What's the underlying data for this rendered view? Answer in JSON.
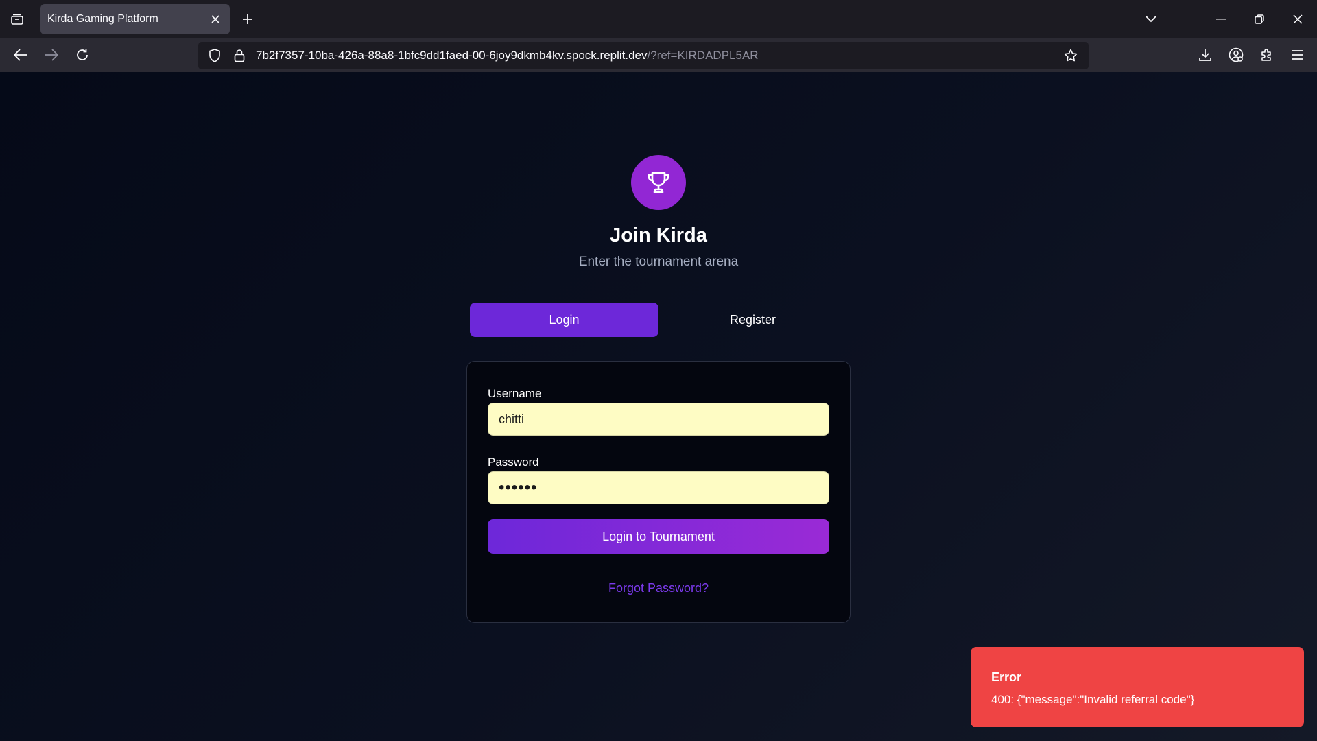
{
  "browser": {
    "tab": {
      "title": "Kirda Gaming Platform"
    },
    "url": {
      "host": "7b2f7357-10ba-426a-88a8-1bfc9dd1faed-00-6joy9dkmb4kv.spock.replit.dev",
      "query": "/?ref=KIRDADPL5AR"
    },
    "icons": {
      "tab_list": "tab-list-icon",
      "tab_close": "close-icon",
      "new_tab": "plus-icon",
      "list_all_tabs": "chevron-down-icon",
      "minimize": "minimize-icon",
      "restore": "restore-icon",
      "close_window": "close-icon",
      "back": "arrow-left-icon",
      "forward": "arrow-right-icon",
      "reload": "reload-icon",
      "shield": "shield-icon",
      "lock": "lock-icon",
      "bookmark": "star-icon",
      "downloads": "download-icon",
      "account": "account-icon",
      "extensions": "puzzle-icon",
      "menu": "hamburger-icon"
    }
  },
  "header": {
    "logo_icon": "trophy-icon",
    "title": "Join Kirda",
    "subtitle": "Enter the tournament arena"
  },
  "auth_tabs": {
    "login": "Login",
    "register": "Register",
    "active": "login"
  },
  "form": {
    "username_label": "Username",
    "username_value": "chitti",
    "password_label": "Password",
    "password_value": "••••••",
    "submit_label": "Login to Tournament",
    "forgot_label": "Forgot Password?"
  },
  "toast": {
    "title": "Error",
    "message": "400: {\"message\":\"Invalid referral code\"}"
  },
  "colors": {
    "accent": "#6d28d9",
    "logo_bg": "#9227d4",
    "error": "#ef4444",
    "input_bg": "#fefcc4",
    "link": "#7c3aed"
  }
}
